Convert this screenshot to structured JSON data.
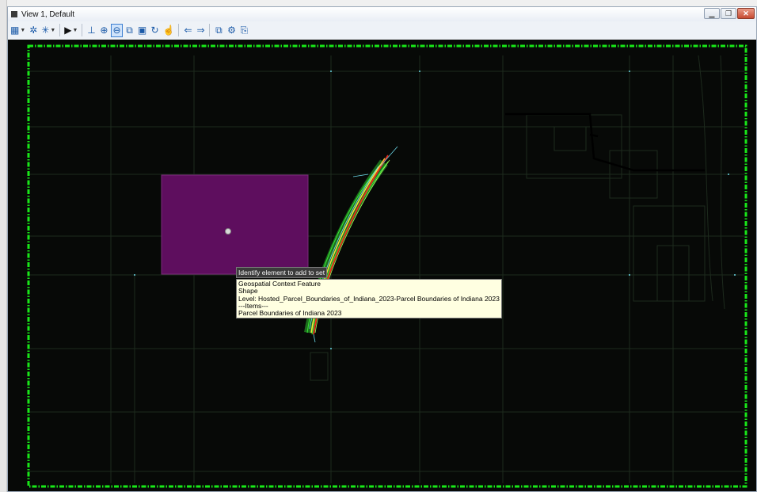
{
  "window": {
    "title": "View 1, Default",
    "controls": [
      "minimize",
      "restore",
      "close"
    ]
  },
  "toolbar": {
    "items": [
      {
        "name": "view-attributes-icon",
        "glyph": "▦",
        "caret": true
      },
      {
        "name": "display-style-icon",
        "glyph": "✲",
        "caret": false
      },
      {
        "name": "lighting-icon",
        "glyph": "✳",
        "caret": true
      },
      {
        "name": "select-arrow-icon",
        "glyph": "▶",
        "caret": true
      },
      {
        "name": "clip-volume-icon",
        "glyph": "⊥",
        "caret": false
      },
      {
        "name": "zoom-in-icon",
        "glyph": "⊕",
        "caret": false
      },
      {
        "name": "zoom-out-icon",
        "glyph": "⊖",
        "caret": false,
        "active": true
      },
      {
        "name": "window-area-icon",
        "glyph": "⧉",
        "caret": false
      },
      {
        "name": "fit-view-icon",
        "glyph": "▣",
        "caret": false
      },
      {
        "name": "rotate-view-icon",
        "glyph": "↻",
        "caret": false
      },
      {
        "name": "pan-view-icon",
        "glyph": "☝",
        "caret": false
      },
      {
        "name": "previous-view-icon",
        "glyph": "⇐",
        "caret": false
      },
      {
        "name": "next-view-icon",
        "glyph": "⇒",
        "caret": false
      },
      {
        "name": "copy-view-icon",
        "glyph": "⧉",
        "caret": false
      },
      {
        "name": "view-camera-icon",
        "glyph": "⚙",
        "caret": false
      },
      {
        "name": "save-view-icon",
        "glyph": "⎘",
        "caret": false
      }
    ]
  },
  "viewport": {
    "background": "#070907",
    "boundary_color": "#18e818",
    "shape_fill": "#5e0e5e",
    "corridor_color": "#37e837"
  },
  "tooltip_prompt": "Identify element to add to set",
  "tooltip_info": {
    "line1": "Geospatial Context Feature",
    "line2": "Shape",
    "line3": "Level: Hosted_Parcel_Boundaries_of_Indiana_2023-Parcel Boundaries of Indiana 2023",
    "line4": "---Items---",
    "line5": "Parcel Boundaries of Indiana 2023"
  }
}
